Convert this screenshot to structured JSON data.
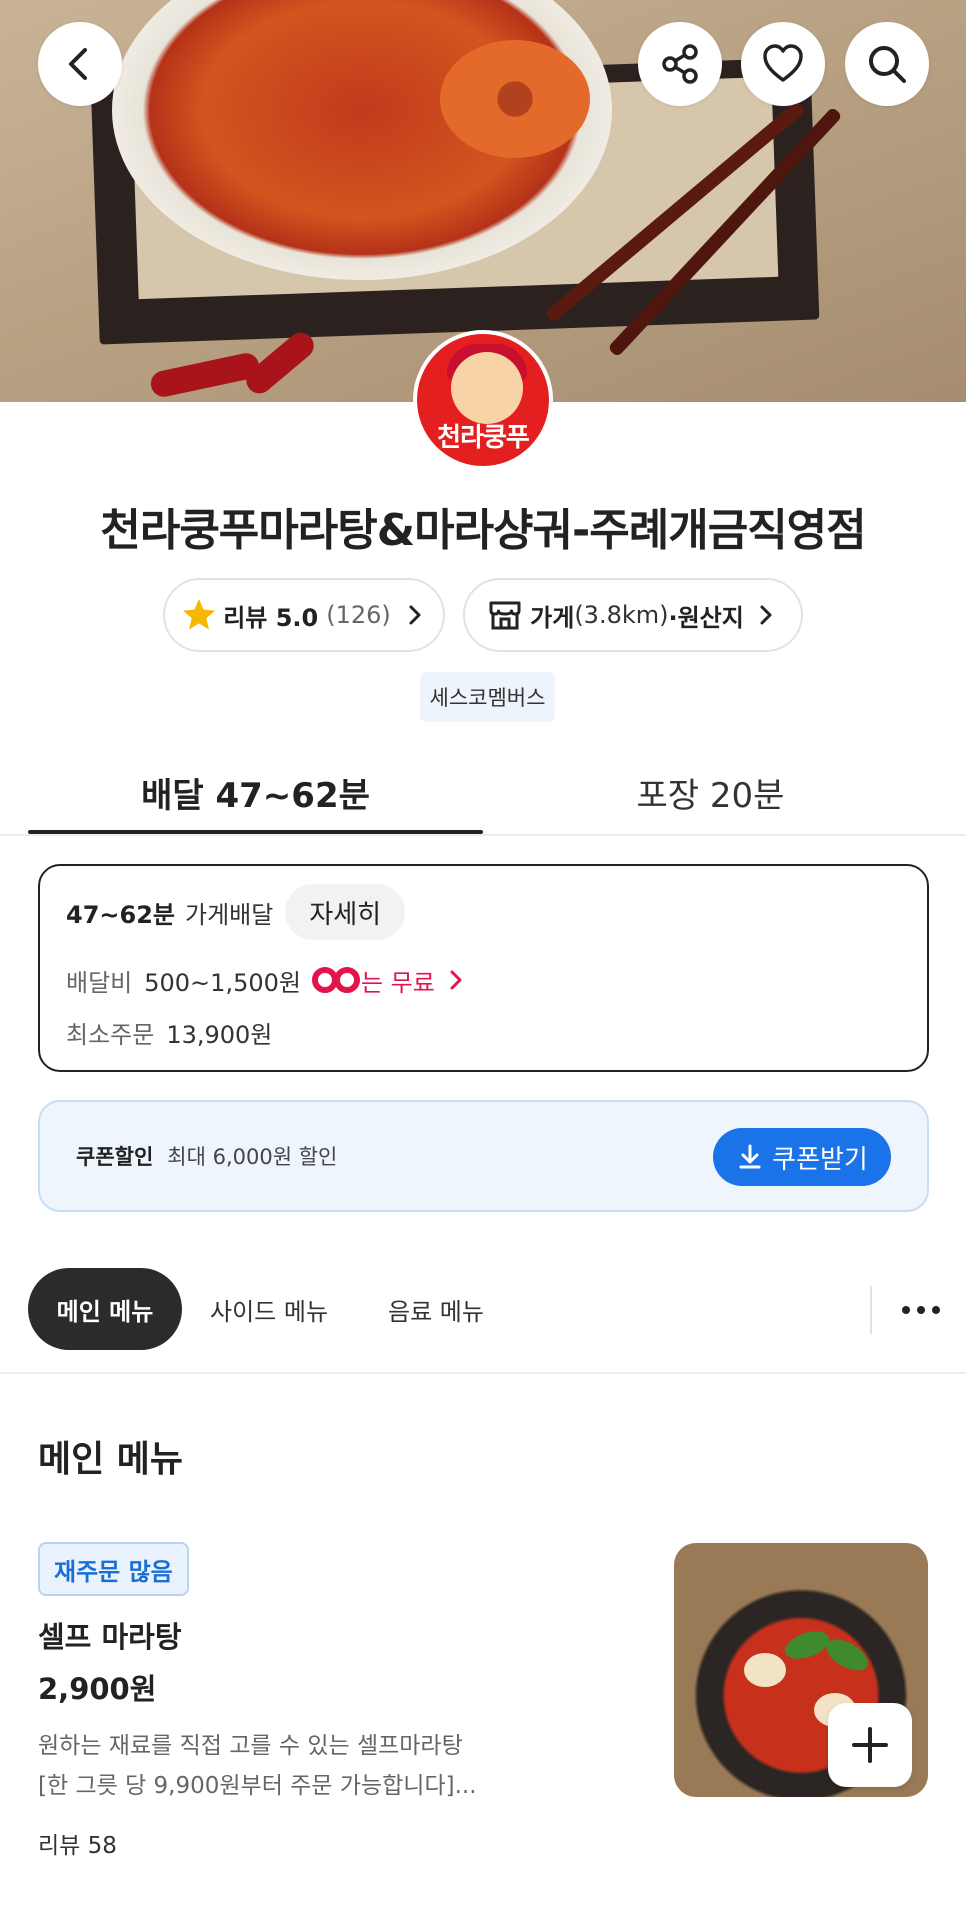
{
  "header": {
    "back_icon": "chevron-left-icon",
    "share_icon": "share-icon",
    "like_icon": "heart-icon",
    "search_icon": "search-icon"
  },
  "store": {
    "logo_text": "천라쿵푸",
    "name": "천라쿵푸마라탕&마라샹궈-주례개금직영점",
    "review_label": "리뷰 5.0",
    "review_count": "(126)",
    "info_label": "가게",
    "info_distance": "(3.8km)",
    "info_suffix": "·원산지",
    "tag": "세스코멤버스"
  },
  "tabs": {
    "delivery": "배달 47~62분",
    "pickup": "포장 20분"
  },
  "delivery": {
    "time": "47~62분",
    "type": "가게배달",
    "detail_button": "자세히",
    "fee_label": "배달비",
    "fee_value": "500~1,500원",
    "free_text": "는 무료",
    "min_order_label": "최소주문",
    "min_order_value": "13,900원"
  },
  "coupon": {
    "label": "쿠폰할인",
    "desc": "최대 6,000원 할인",
    "button": "쿠폰받기"
  },
  "categories": [
    "메인 메뉴",
    "사이드 메뉴",
    "음료 메뉴"
  ],
  "section": {
    "title": "메인 메뉴"
  },
  "menu_item": {
    "badge": "재주문 많음",
    "name": "셀프 마라탕",
    "price": "2,900원",
    "desc_line1": "원하는 재료를 직접 고를 수 있는 셀프마라탕",
    "desc_line2": "[한 그릇 당 9,900원부터 주문 가능합니다]...",
    "reviews": "리뷰 58"
  },
  "colors": {
    "accent_blue": "#1a73e8",
    "free_pink": "#e3134c",
    "star": "#f5b800"
  }
}
